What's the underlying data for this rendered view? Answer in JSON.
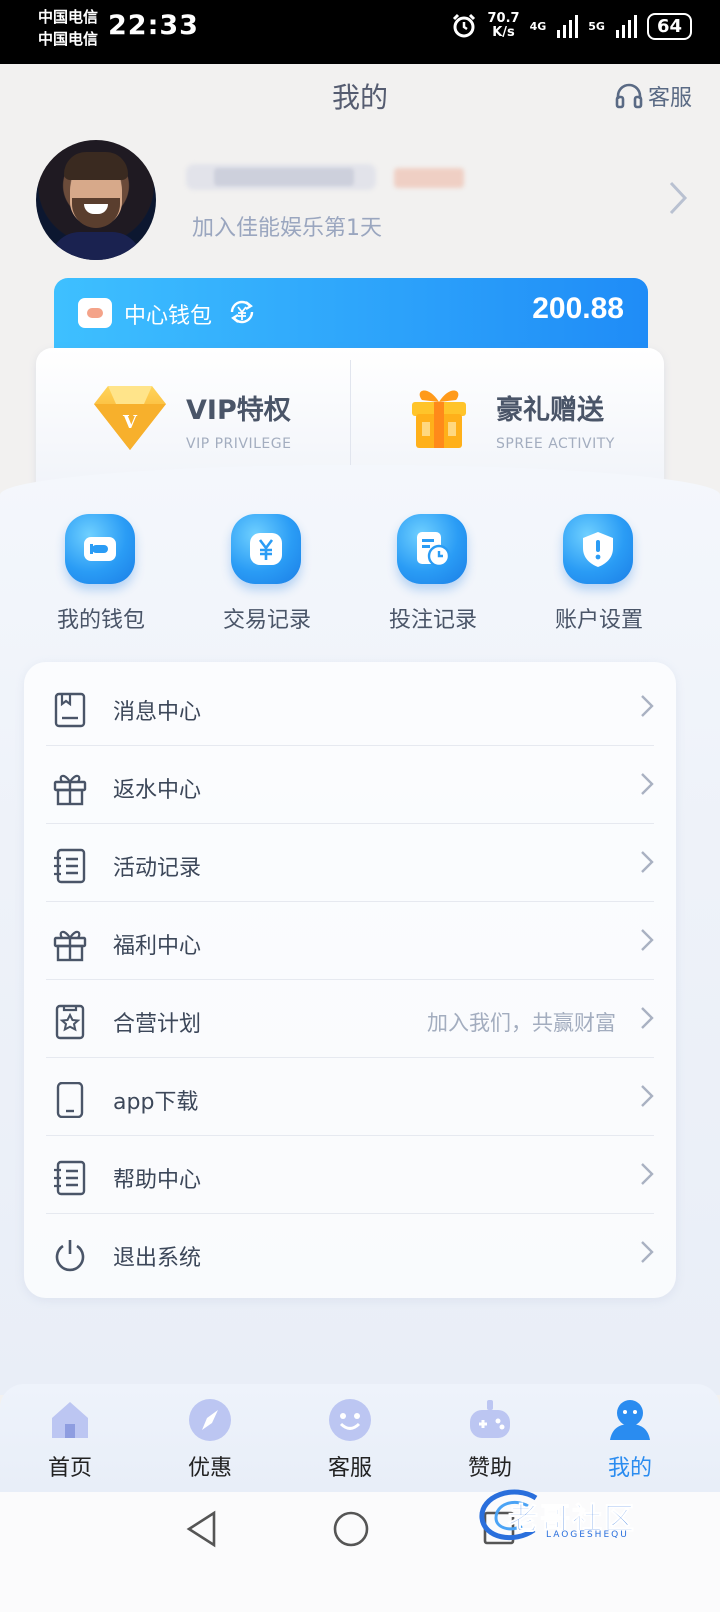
{
  "status_bar": {
    "carrier_1": "中国电信",
    "carrier_2": "中国电信",
    "time": "22:33",
    "speed_value": "70.7",
    "speed_unit": "K/s",
    "net_1": "4G",
    "net_2": "5G",
    "battery": "64"
  },
  "header": {
    "title": "我的",
    "service_label": "客服"
  },
  "profile": {
    "join_text": "加入佳能娱乐第1天"
  },
  "wallet": {
    "label": "中心钱包",
    "amount": "200.88"
  },
  "privileges": [
    {
      "title": "VIP特权",
      "subtitle": "VIP PRIVILEGE"
    },
    {
      "title": "豪礼赠送",
      "subtitle": "SPREE ACTIVITY"
    }
  ],
  "quick_actions": [
    {
      "label": "我的钱包",
      "icon": "wallet-icon"
    },
    {
      "label": "交易记录",
      "icon": "yen-icon"
    },
    {
      "label": "投注记录",
      "icon": "bet-record-icon"
    },
    {
      "label": "账户设置",
      "icon": "shield-icon"
    }
  ],
  "menu": [
    {
      "label": "消息中心",
      "icon": "message-icon",
      "extra": ""
    },
    {
      "label": "返水中心",
      "icon": "gift-icon",
      "extra": ""
    },
    {
      "label": "活动记录",
      "icon": "list-icon",
      "extra": ""
    },
    {
      "label": "福利中心",
      "icon": "gift-icon",
      "extra": ""
    },
    {
      "label": "合营计划",
      "icon": "star-card-icon",
      "extra": "加入我们，共赢财富"
    },
    {
      "label": "app下载",
      "icon": "phone-icon",
      "extra": ""
    },
    {
      "label": "帮助中心",
      "icon": "list-icon",
      "extra": ""
    },
    {
      "label": "退出系统",
      "icon": "power-icon",
      "extra": ""
    }
  ],
  "tabs": [
    {
      "label": "首页",
      "icon": "home-icon"
    },
    {
      "label": "优惠",
      "icon": "compass-icon"
    },
    {
      "label": "客服",
      "icon": "chat-face-icon"
    },
    {
      "label": "赞助",
      "icon": "gamepad-icon"
    },
    {
      "label": "我的",
      "icon": "user-icon",
      "active": true
    }
  ],
  "watermark": {
    "text": "老哥社区",
    "sub": "LAOGESHEQU"
  },
  "colors": {
    "accent": "#2a8cf0",
    "wallet_gradient_start": "#3ec0ff",
    "wallet_gradient_end": "#1f8cf7",
    "text_primary": "#3c4759",
    "text_muted": "#a3adbf"
  }
}
